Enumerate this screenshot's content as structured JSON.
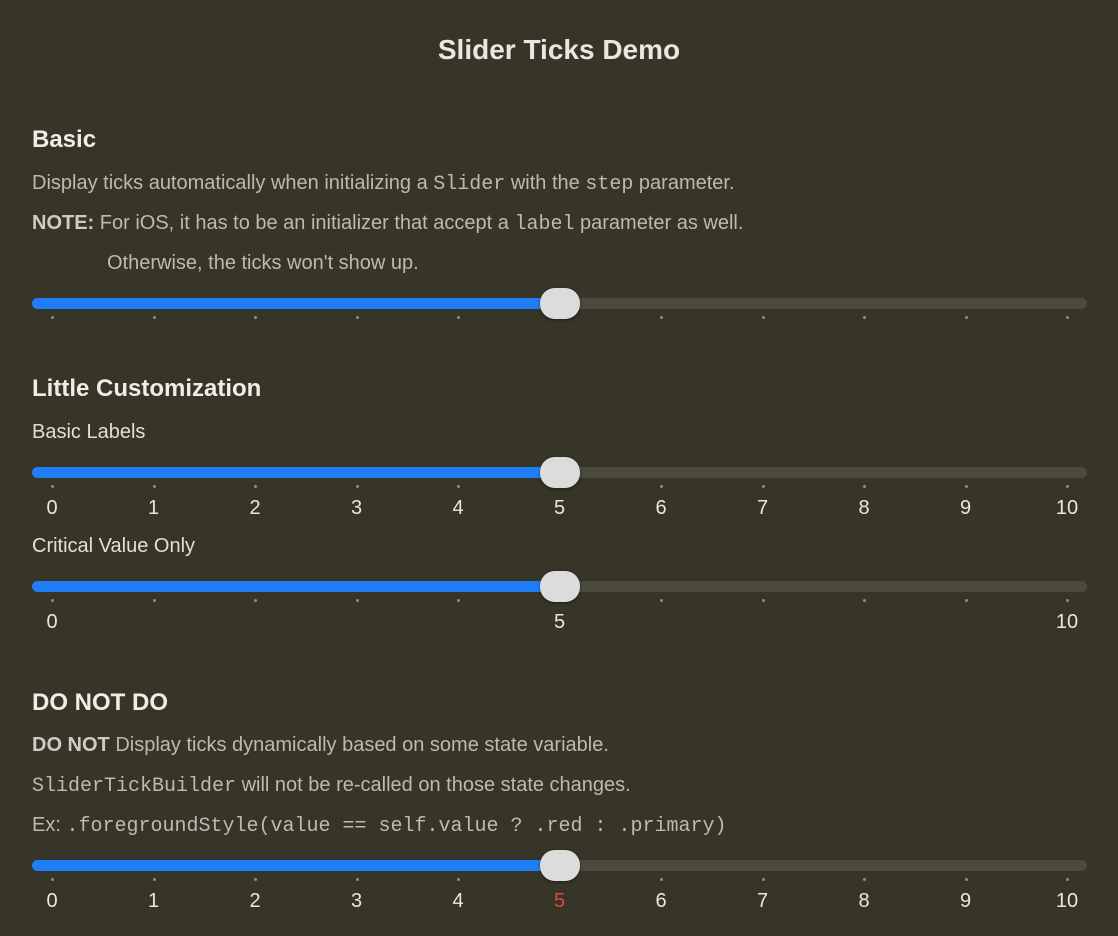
{
  "window": {
    "title": "Slider Ticks Demo"
  },
  "sections": {
    "basic": {
      "heading": "Basic",
      "line1": {
        "pre": "Display ticks automatically when initializing a ",
        "code1": "Slider",
        "mid": " with the ",
        "code2": "step",
        "post": " parameter."
      },
      "line2": {
        "strong": "NOTE:",
        "pre": " For iOS, it has to be an initializer that accept a ",
        "code": "label",
        "post": " parameter as well."
      },
      "line3": "Otherwise, the ticks won't show up.",
      "slider": {
        "value": 5,
        "min": 0,
        "max": 10,
        "step": 1,
        "labels": []
      }
    },
    "little": {
      "heading": "Little Customization",
      "basic_labels": {
        "label": "Basic Labels",
        "slider": {
          "value": 5,
          "min": 0,
          "max": 10,
          "step": 1,
          "labels": [
            "0",
            "1",
            "2",
            "3",
            "4",
            "5",
            "6",
            "7",
            "8",
            "9",
            "10"
          ]
        }
      },
      "critical": {
        "label": "Critical Value Only",
        "slider": {
          "value": 5,
          "min": 0,
          "max": 10,
          "step": 1,
          "labels": [
            "0",
            "",
            "",
            "",
            "",
            "5",
            "",
            "",
            "",
            "",
            "10"
          ]
        }
      }
    },
    "donot": {
      "heading": "DO NOT DO",
      "line1": {
        "strong": "DO NOT",
        "post": " Display ticks dynamically based on some state variable."
      },
      "line2": {
        "code": "SliderTickBuilder",
        "post": " will not be re-called on those state changes."
      },
      "line3": {
        "pre": "Ex: ",
        "code": ".foregroundStyle(value == self.value ? .red : .primary)"
      },
      "slider": {
        "value": 5,
        "min": 0,
        "max": 10,
        "step": 1,
        "labels": [
          "0",
          "1",
          "2",
          "3",
          "4",
          "5",
          "6",
          "7",
          "8",
          "9",
          "10"
        ],
        "highlight_index": 5
      }
    }
  },
  "colors": {
    "background": "#363527",
    "accent": "#1f7ef5",
    "track": "#4b4a3f",
    "thumb": "#dcdcdc",
    "highlight": "#e4473f"
  }
}
